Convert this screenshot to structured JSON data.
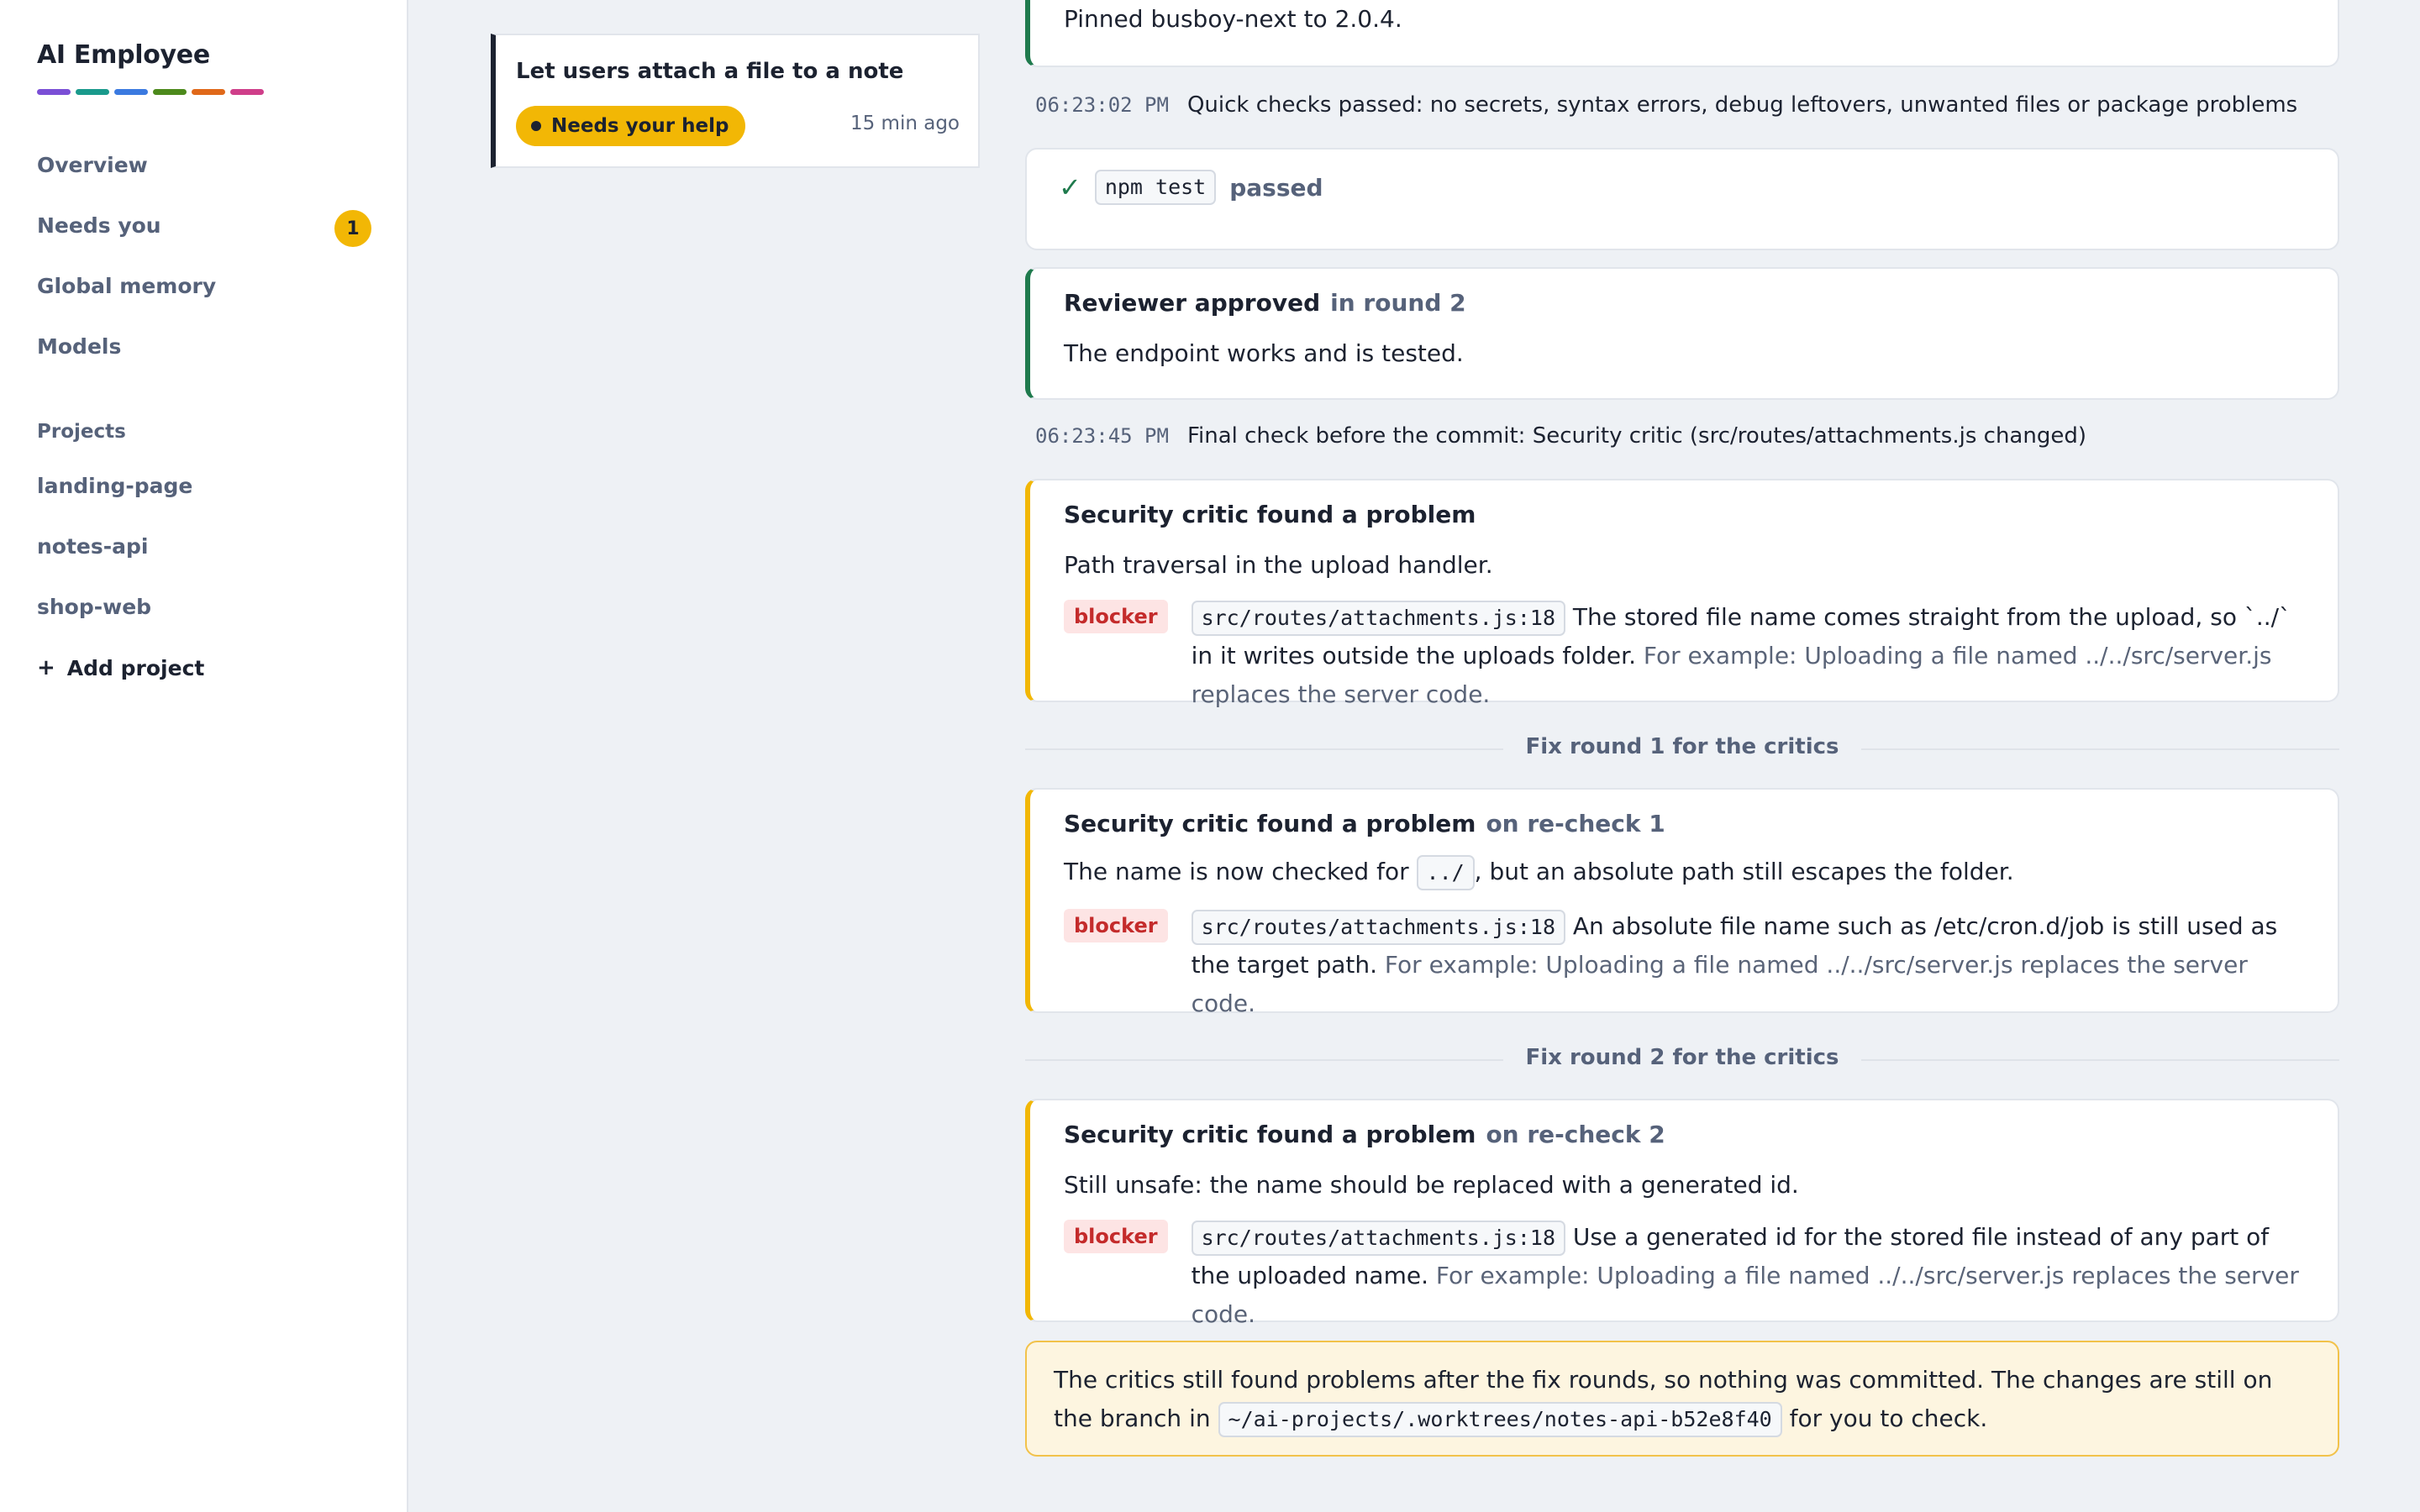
{
  "app": {
    "title": "AI Employee",
    "stripe_colors": [
      "#7b4fd6",
      "#1a9a8c",
      "#3b7ae0",
      "#4d8a1c",
      "#e0691a",
      "#cf3f8a"
    ]
  },
  "sidebar": {
    "nav": [
      {
        "label": "Overview"
      },
      {
        "label": "Needs you",
        "badge": "1"
      },
      {
        "label": "Global memory"
      },
      {
        "label": "Models"
      }
    ],
    "projects_label": "Projects",
    "projects": [
      "landing-page",
      "notes-api",
      "shop-web"
    ],
    "add_project": "Add project"
  },
  "task": {
    "title": "Let users attach a file to a note",
    "status": "Needs your help",
    "time": "15 min ago"
  },
  "timeline": {
    "pinned_text": "Pinned busboy-next to 2.0.4.",
    "quick_checks": {
      "time": "06:23:02 PM",
      "text": "Quick checks passed: no secrets, syntax errors, debug leftovers, unwanted files or package problems"
    },
    "test": {
      "command": "npm test",
      "result": "passed"
    },
    "reviewer": {
      "title": "Reviewer approved",
      "qualifier": "in round 2",
      "text": "The endpoint works and is tested."
    },
    "final_check": {
      "time": "06:23:45 PM",
      "text": "Final check before the commit: Security critic (src/routes/attachments.js changed)"
    },
    "findings": [
      {
        "title": "Security critic found a problem",
        "qualifier": "",
        "summary_pre": "Path traversal in the upload handler.",
        "summary_code": "",
        "summary_post": "",
        "severity": "blocker",
        "location": "src/routes/attachments.js:18",
        "detail": "The stored file name comes straight from the upload, so `../` in it writes outside the uploads folder.",
        "example": "For example: Uploading a file named ../../src/server.js replaces the server code."
      },
      {
        "title": "Security critic found a problem",
        "qualifier": "on re-check 1",
        "summary_pre": "The name is now checked for",
        "summary_code": "../",
        "summary_post": ", but an absolute path still escapes the folder.",
        "severity": "blocker",
        "location": "src/routes/attachments.js:18",
        "detail": "An absolute file name such as /etc/cron.d/job is still used as the target path.",
        "example": "For example: Uploading a file named ../../src/server.js replaces the server code."
      },
      {
        "title": "Security critic found a problem",
        "qualifier": "on re-check 2",
        "summary_pre": "Still unsafe: the name should be replaced with a generated id.",
        "summary_code": "",
        "summary_post": "",
        "severity": "blocker",
        "location": "src/routes/attachments.js:18",
        "detail": "Use a generated id for the stored file instead of any part of the uploaded name.",
        "example": "For example: Uploading a file named ../../src/server.js replaces the server code."
      }
    ],
    "fix_rounds": [
      "Fix round 1 for the critics",
      "Fix round 2 for the critics"
    ],
    "final_message": {
      "pre": "The critics still found problems after the fix rounds, so nothing was committed. The changes are still on the branch in",
      "path": "~/ai-projects/.worktrees/notes-api-b52e8f40",
      "post": "for you to check."
    }
  }
}
